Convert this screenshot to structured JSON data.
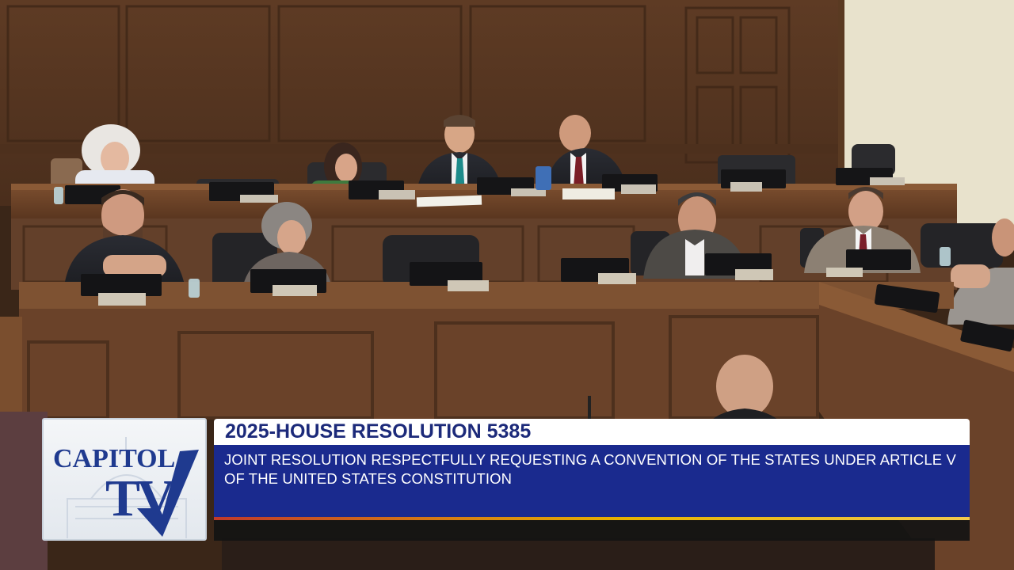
{
  "logo": {
    "word": "CAPITOL",
    "tv": "TV"
  },
  "caption": {
    "title": "2025-HOUSE RESOLUTION 5385",
    "description": "JOINT RESOLUTION RESPECTFULLY REQUESTING A CONVENTION OF THE STATES UNDER ARTICLE V OF THE UNITED STATES CONSTITUTION"
  },
  "colors": {
    "caption_blue": "#1a2a8e",
    "title_text": "#1c2a7a",
    "logo_blue": "#1f3a8f",
    "wood": "#6b4329"
  }
}
